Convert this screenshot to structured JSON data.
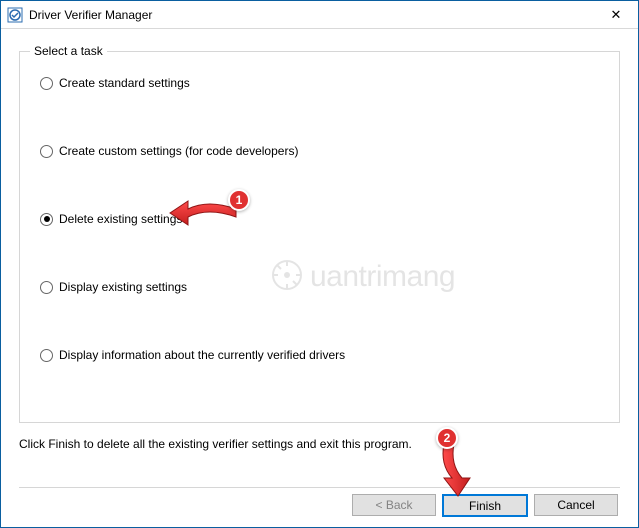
{
  "titlebar": {
    "title": "Driver Verifier Manager",
    "close_glyph": "✕"
  },
  "groupbox": {
    "legend": "Select a task"
  },
  "options": [
    {
      "label": "Create standard settings",
      "checked": false
    },
    {
      "label": "Create custom settings (for code developers)",
      "checked": false
    },
    {
      "label": "Delete existing settings",
      "checked": true
    },
    {
      "label": "Display existing settings",
      "checked": false
    },
    {
      "label": "Display information about the currently verified drivers",
      "checked": false
    }
  ],
  "instruction": "Click Finish to delete all the existing verifier settings and exit this program.",
  "buttons": {
    "back": "< Back",
    "finish": "Finish",
    "cancel": "Cancel"
  },
  "annotations": {
    "badge1": "1",
    "badge2": "2"
  },
  "watermark": {
    "text": "uantrimang"
  }
}
